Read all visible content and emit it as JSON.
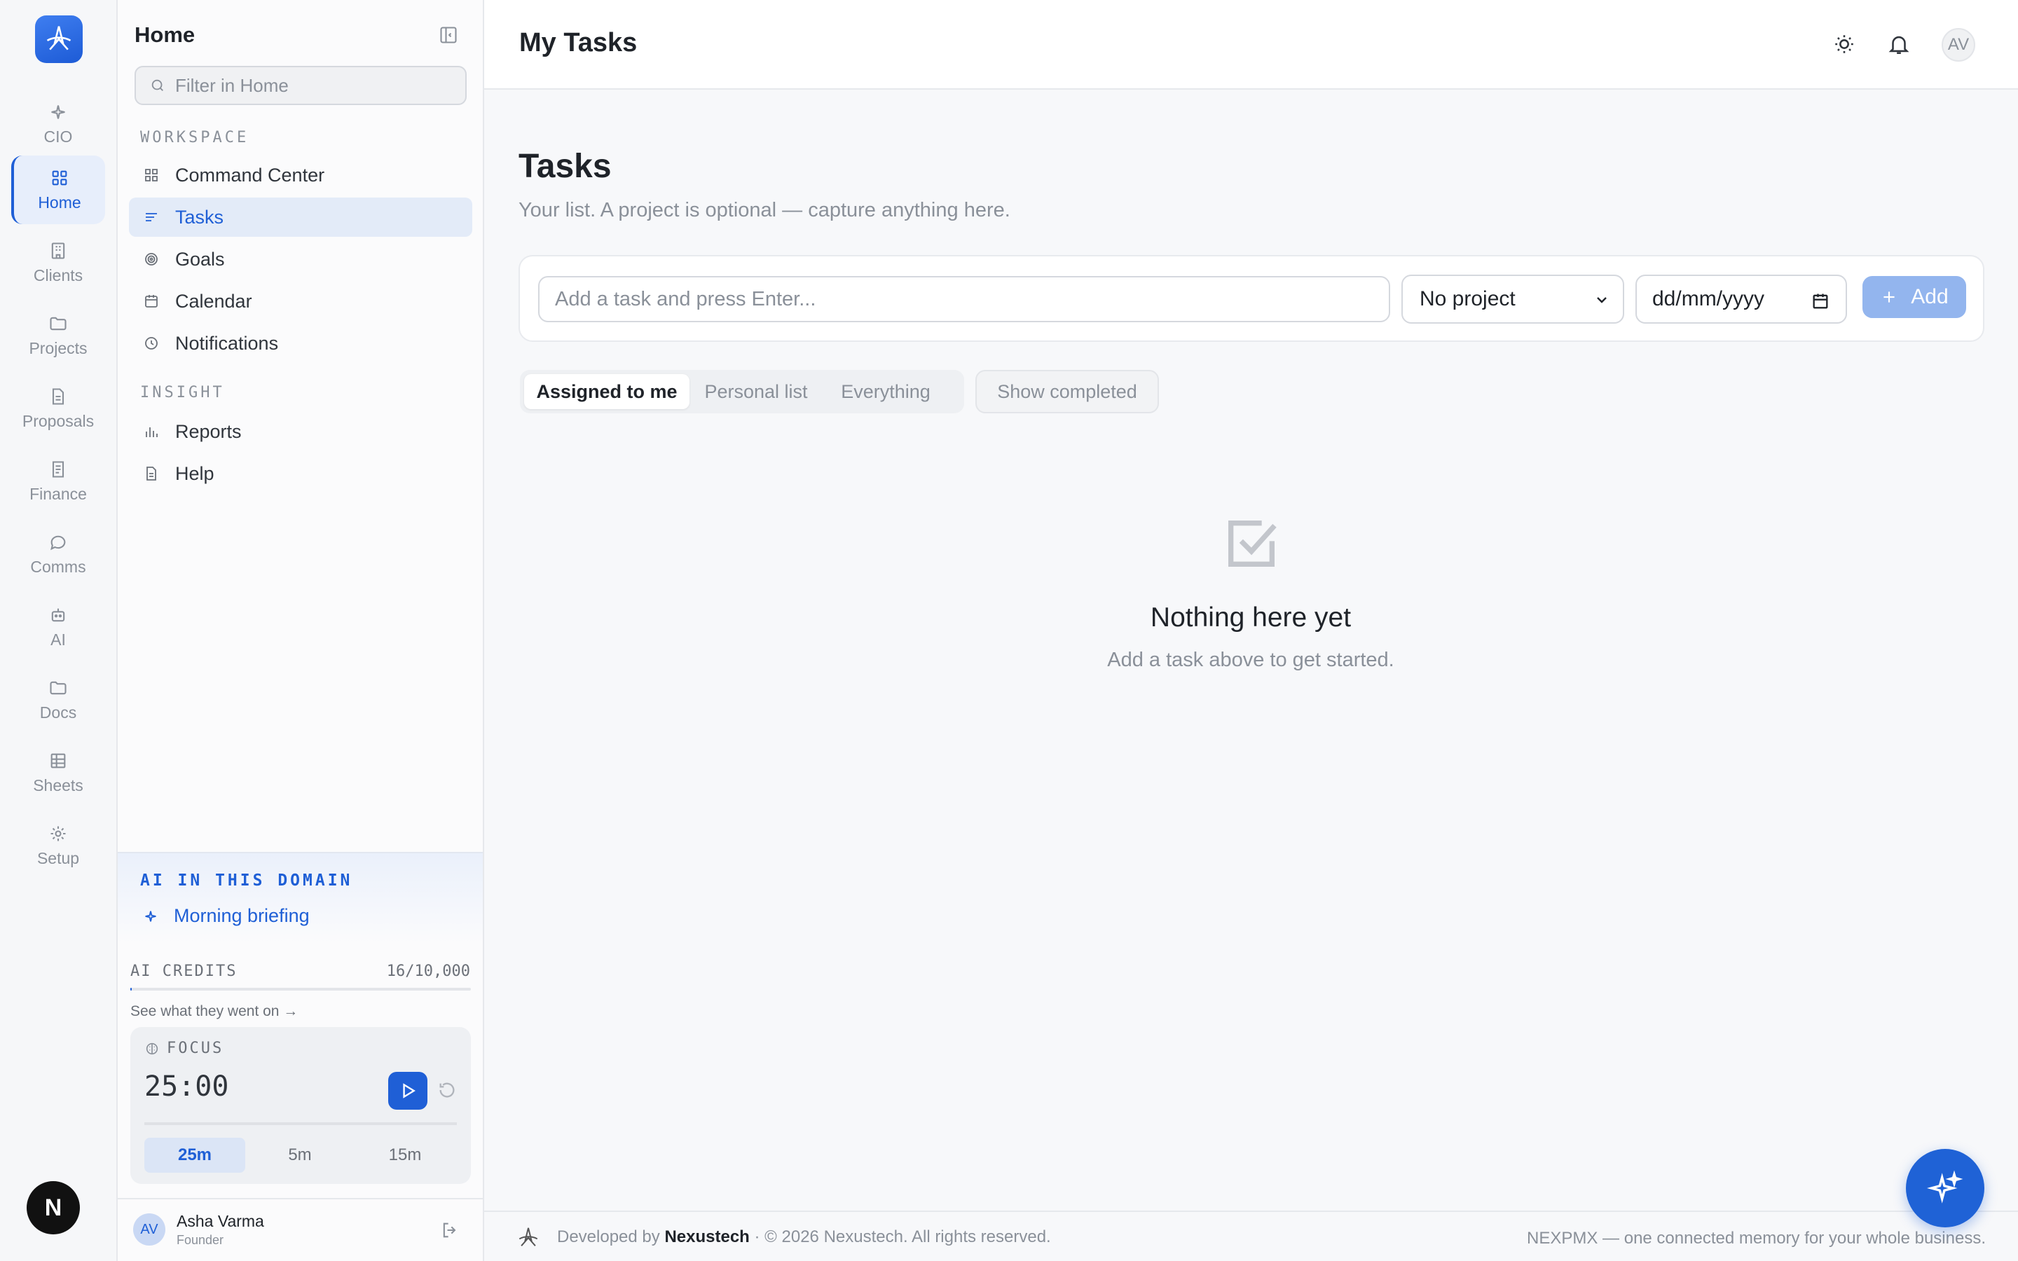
{
  "rail": {
    "items": [
      {
        "label": "CIO",
        "icon": "sparkle-icon"
      },
      {
        "label": "Home",
        "icon": "grid-icon",
        "active": true
      },
      {
        "label": "Clients",
        "icon": "building-icon"
      },
      {
        "label": "Projects",
        "icon": "folder-icon"
      },
      {
        "label": "Proposals",
        "icon": "document-icon"
      },
      {
        "label": "Finance",
        "icon": "receipt-icon"
      },
      {
        "label": "Comms",
        "icon": "chat-icon"
      },
      {
        "label": "AI",
        "icon": "robot-icon"
      },
      {
        "label": "Docs",
        "icon": "folder-icon"
      },
      {
        "label": "Sheets",
        "icon": "table-icon"
      },
      {
        "label": "Setup",
        "icon": "gear-icon"
      }
    ],
    "bottom_badge": "N"
  },
  "sidebar": {
    "title": "Home",
    "filter_placeholder": "Filter in Home",
    "sections": [
      {
        "label": "WORKSPACE",
        "items": [
          "Command Center",
          "Tasks",
          "Goals",
          "Calendar",
          "Notifications"
        ]
      },
      {
        "label": "INSIGHT",
        "items": [
          "Reports",
          "Help"
        ]
      }
    ],
    "active_item": "Tasks",
    "ai_domain": {
      "label": "AI IN THIS DOMAIN",
      "item": "Morning briefing"
    },
    "credits": {
      "label": "AI CREDITS",
      "value": "16/10,000",
      "used_fraction": 0.0016,
      "link": "See what they went on →"
    },
    "focus": {
      "label": "FOCUS",
      "time": "25:00",
      "durations": [
        "25m",
        "5m",
        "15m"
      ],
      "selected_duration": "25m"
    },
    "user": {
      "initials": "AV",
      "name": "Asha Varma",
      "role": "Founder"
    }
  },
  "topbar": {
    "title": "My Tasks",
    "avatar": "AV"
  },
  "main": {
    "heading": "Tasks",
    "subheading": "Your list. A project is optional — capture anything here.",
    "task_input_placeholder": "Add a task and press Enter...",
    "project_select": "No project",
    "date_placeholder": "dd/mm/yyyy",
    "add_label": "Add",
    "filters": [
      "Assigned to me",
      "Personal list",
      "Everything"
    ],
    "selected_filter": "Assigned to me",
    "show_completed": "Show completed",
    "empty": {
      "title": "Nothing here yet",
      "subtitle": "Add a task above to get started."
    }
  },
  "footer": {
    "developed_by": "Developed by",
    "company": "Nexustech",
    "copyright": "· © 2026 Nexustech. All rights reserved.",
    "tagline": "NEXPMX — one connected memory for your whole business."
  },
  "colors": {
    "accent": "#1f5fd6",
    "add_button": "#93b5ee",
    "fab": "#1f62d6"
  }
}
